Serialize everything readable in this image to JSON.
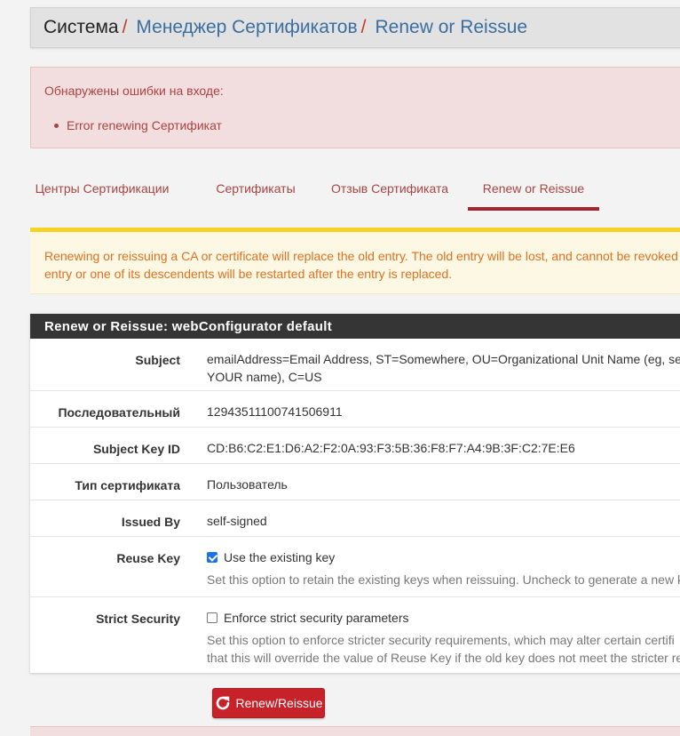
{
  "breadcrumb": {
    "root": "Система",
    "sep": "/",
    "level1": "Менеджер Сертификатов",
    "level2": "Renew or Reissue"
  },
  "error": {
    "title": "Обнаружены ошибки на входе:",
    "items": [
      "Error renewing Сертификат"
    ]
  },
  "tabs": [
    {
      "label": "Центры Сертификации",
      "active": false
    },
    {
      "label": "Сертификаты",
      "active": false
    },
    {
      "label": "Отзыв Сертификата",
      "active": false
    },
    {
      "label": "Renew or Reissue",
      "active": true
    }
  ],
  "warning": {
    "line1": "Renewing or reissuing a CA or certificate will replace the old entry. The old entry will be lost, and cannot be revoked a",
    "line2": "entry or one of its descendents will be restarted after the entry is replaced."
  },
  "panel": {
    "title": "Renew or Reissue: webConfigurator default",
    "rows": {
      "subject": {
        "label": "Subject",
        "line1": "emailAddress=Email Address, ST=Somewhere, OU=Organizational Unit Name (eg, sect",
        "line2": "YOUR name), C=US"
      },
      "serial": {
        "label": "Последовательный",
        "value": "12943511100741506911"
      },
      "skid": {
        "label": "Subject Key ID",
        "value": "CD:B6:C2:E1:D6:A2:F2:0A:93:F3:5B:36:F8:F7:A4:9B:3F:C2:7E:E6"
      },
      "cert_type": {
        "label": "Тип сертификата",
        "value": "Пользователь"
      },
      "issued_by": {
        "label": "Issued By",
        "value": "self-signed"
      },
      "reuse_key": {
        "label": "Reuse Key",
        "checkbox_label": "Use the existing key",
        "checked": true,
        "help": "Set this option to retain the existing keys when reissuing. Uncheck to generate a new k"
      },
      "strict_security": {
        "label": "Strict Security",
        "checkbox_label": "Enforce strict security parameters",
        "checked": false,
        "help1": "Set this option to enforce stricter security requirements, which may alter certain certifi",
        "help2": "that this will override the value of Reuse Key if the old key does not meet the stricter re"
      }
    }
  },
  "button": {
    "label": "Renew/Reissue",
    "icon": "refresh-icon"
  },
  "colors": {
    "accent_red": "#c72229",
    "link_blue": "#3a6e9f",
    "error_bg": "#f2dede",
    "warning_text": "#e07020",
    "warning_border": "#f4d324",
    "panel_header": "#353535"
  }
}
